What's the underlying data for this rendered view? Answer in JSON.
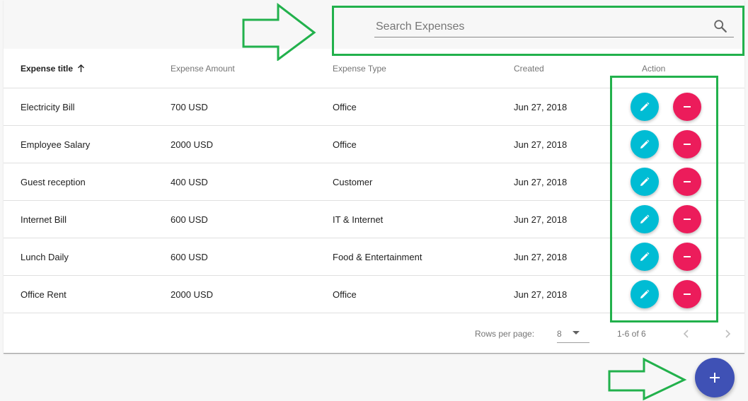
{
  "search": {
    "placeholder": "Search Expenses",
    "value": ""
  },
  "table": {
    "columns": [
      "Expense title",
      "Expense Amount",
      "Expense Type",
      "Created",
      "Action"
    ],
    "sorted_column": "Expense title",
    "sort_direction": "ascending",
    "rows": [
      {
        "title": "Electricity Bill",
        "amount": "700 USD",
        "type": "Office",
        "created": "Jun 27, 2018"
      },
      {
        "title": "Employee Salary",
        "amount": "2000 USD",
        "type": "Office",
        "created": "Jun 27, 2018"
      },
      {
        "title": "Guest reception",
        "amount": "400 USD",
        "type": "Customer",
        "created": "Jun 27, 2018"
      },
      {
        "title": "Internet Bill",
        "amount": "600 USD",
        "type": "IT & Internet",
        "created": "Jun 27, 2018"
      },
      {
        "title": "Lunch Daily",
        "amount": "600 USD",
        "type": "Food & Entertainment",
        "created": "Jun 27, 2018"
      },
      {
        "title": "Office Rent",
        "amount": "2000 USD",
        "type": "Office",
        "created": "Jun 27, 2018"
      }
    ]
  },
  "pagination": {
    "rows_per_page_label": "Rows per page:",
    "rows_per_page": "8",
    "range": "1-6 of 6"
  },
  "icons": {
    "search": "search-icon",
    "sort": "arrow-up-icon",
    "edit": "pencil-icon",
    "delete": "minus-icon",
    "add": "plus-icon",
    "prev": "chevron-left-icon",
    "next": "chevron-right-icon",
    "dropdown": "caret-down-icon"
  },
  "colors": {
    "edit_button": "#00bcd4",
    "delete_button": "#ec1c5b",
    "add_button": "#3f51b5",
    "annotation": "#22b14c"
  }
}
